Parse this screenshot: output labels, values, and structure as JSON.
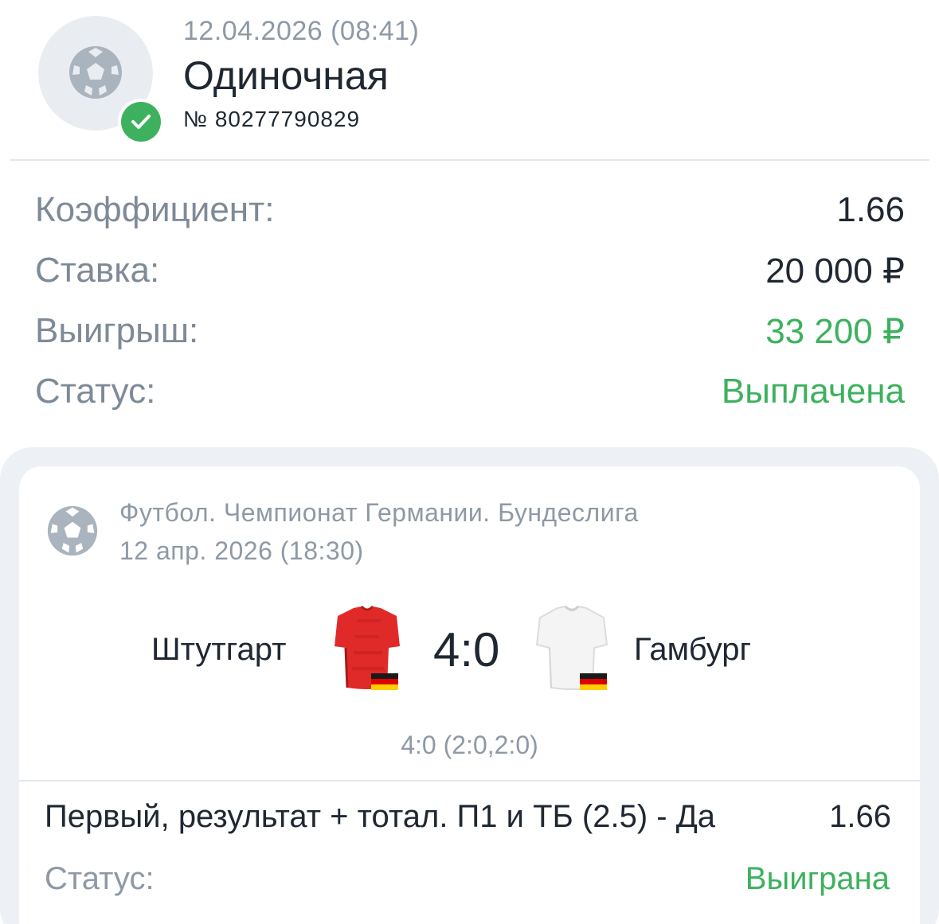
{
  "header": {
    "datetime": "12.04.2026 (08:41)",
    "bet_type": "Одиночная",
    "bet_number": "№ 80277790829",
    "sport_icon": "football-icon",
    "status_icon": "check-circle-icon"
  },
  "summary": {
    "rows": [
      {
        "label": "Коэффициент:",
        "value": "1.66"
      },
      {
        "label": "Ставка:",
        "value": "20 000 ₽"
      },
      {
        "label": "Выигрыш:",
        "value": "33 200 ₽"
      },
      {
        "label": "Статус:",
        "value": "Выплачена"
      }
    ]
  },
  "event": {
    "sport_icon": "football-icon",
    "league": "Футбол. Чемпионат Германии. Бундеслига",
    "date": "12 апр. 2026 (18:30)",
    "home_team": "Штутгарт",
    "away_team": "Гамбург",
    "home_jersey_icon": "red-jersey-icon",
    "away_jersey_icon": "white-jersey-icon",
    "flag_icon": "germany-flag-icon",
    "score": "4:0",
    "score_detail": "4:0 (2:0,2:0)",
    "market": "Первый, результат + тотал. П1 и ТБ (2.5) - Да",
    "odds": "1.66",
    "status_label": "Статус:",
    "status_value": "Выиграна"
  },
  "colors": {
    "accent_green": "#3db15e",
    "muted_text": "#8e99a6",
    "primary_text": "#1f2732",
    "card_bg": "#edf1f5",
    "home_jersey": "#e02a2a",
    "away_jersey": "#f4f4f4"
  }
}
